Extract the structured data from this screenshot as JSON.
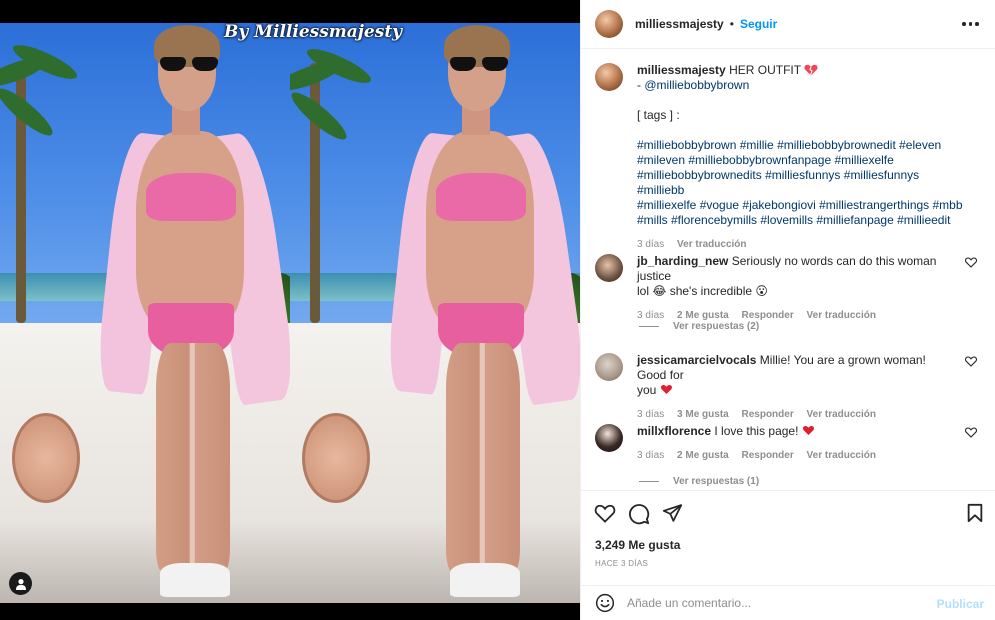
{
  "media": {
    "watermark": "By Milliessmajesty",
    "tag_button_icon": "user-icon"
  },
  "header": {
    "username": "milliessmajesty",
    "separator": "•",
    "follow_label": "Seguir",
    "more_icon": "more-options-icon"
  },
  "caption": {
    "username": "milliessmajesty",
    "text": "HER OUTFIT",
    "emoji": "broken-heart-icon",
    "line2_prefix": "- ",
    "mention": "@milliebobbybrown",
    "tags_label": "[ tags ] :",
    "hashtags": [
      "#milliebobbybrown #millie #milliebobbybrownedit #eleven",
      "#mileven #milliebobbybrownfanpage #milliexelfe",
      "#milliebobbybrownedits #milliesfunnys #milliesfunnys #milliebb",
      "#milliexelfe #vogue #jakebongiovi #milliestrangerthings #mbb",
      "#mills #florencebymills #lovemills #milliefanpage #millieedit"
    ],
    "time": "3 días",
    "translate": "Ver traducción"
  },
  "comments": [
    {
      "username": "jb_harding_new",
      "text": "Seriously no words can do this woman justice",
      "text2": "lol 😂 she's incredible 😮",
      "time": "3 días",
      "likes": "2 Me gusta",
      "reply": "Responder",
      "translate": "Ver traducción",
      "replies": "Ver respuestas (2)"
    },
    {
      "username": "jessicamarcielvocals",
      "text": "Millie! You are a grown woman! Good for",
      "text2": "you",
      "time": "3 días",
      "likes": "3 Me gusta",
      "reply": "Responder",
      "translate": "Ver traducción"
    },
    {
      "username": "millxflorence",
      "text": "I love this page!",
      "time": "3 días",
      "likes": "2 Me gusta",
      "reply": "Responder",
      "translate": "Ver traducción",
      "replies": "Ver respuestas (1)"
    }
  ],
  "actions": {
    "like_icon": "heart-icon",
    "comment_icon": "comment-icon",
    "share_icon": "send-icon",
    "save_icon": "bookmark-icon",
    "likes": "3,249 Me gusta",
    "ago": "HACE 3 DÍAS"
  },
  "add_comment": {
    "emoji_icon": "smiley-icon",
    "placeholder": "Añade un comentario...",
    "publish": "Publicar"
  },
  "colors": {
    "link": "#0095f6",
    "hashtag": "#00376b",
    "muted": "#8e8e8e",
    "heart": "#ed4956"
  }
}
